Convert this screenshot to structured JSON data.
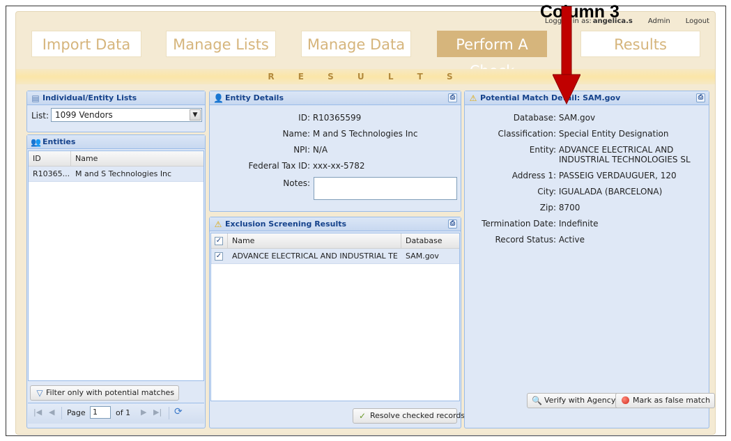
{
  "annotation": {
    "label": "Column 3",
    "arrow_color": "#c00000"
  },
  "user_bar": {
    "logged_as_label": "Logged in as:",
    "username": "angelica.s",
    "admin": "Admin",
    "logout": "Logout"
  },
  "nav": {
    "tabs": [
      "Import Data",
      "Manage Lists",
      "Manage Data",
      "Perform A Check",
      "Results"
    ],
    "active": "Perform A Check"
  },
  "section_title": "R E S U L T S",
  "lists_panel": {
    "title": "Individual/Entity Lists",
    "list_label": "List:",
    "list_value": "1099 Vendors"
  },
  "entities_panel": {
    "title": "Entities",
    "columns": [
      "ID",
      "Name"
    ],
    "rows": [
      [
        "R10365...",
        "M and S Technologies Inc"
      ]
    ],
    "filter_button": "Filter only with potential matches",
    "pager": {
      "page_label": "Page",
      "page_value": "1",
      "of_label": "of 1"
    }
  },
  "entity_details": {
    "title": "Entity Details",
    "fields": [
      {
        "label": "ID:",
        "value": "R10365599"
      },
      {
        "label": "Name:",
        "value": "M and S Technologies Inc"
      },
      {
        "label": "NPI:",
        "value": "N/A"
      },
      {
        "label": "Federal Tax ID:",
        "value": "xxx-xx-5782"
      },
      {
        "label": "Notes:",
        "value": ""
      }
    ]
  },
  "exclusion_panel": {
    "title": "Exclusion Screening Results",
    "columns": [
      "Name",
      "Database"
    ],
    "rows": [
      [
        "ADVANCE ELECTRICAL AND INDUSTRIAL TEC...",
        "SAM.gov"
      ]
    ],
    "resolve_button": "Resolve checked records"
  },
  "match_panel": {
    "title": "Potential Match Detail: SAM.gov",
    "fields": [
      {
        "label": "Database:",
        "value": "SAM.gov"
      },
      {
        "label": "Classification:",
        "value": "Special Entity Designation"
      },
      {
        "label": "Entity:",
        "value": "ADVANCE ELECTRICAL AND",
        "value2": "INDUSTRIAL TECHNOLOGIES SL"
      },
      {
        "label": "Address 1:",
        "value": "PASSEIG VERDAUGUER, 120"
      },
      {
        "label": "City:",
        "value": "IGUALADA (BARCELONA)"
      },
      {
        "label": "Zip:",
        "value": "8700"
      },
      {
        "label": "Termination Date:",
        "value": "Indefinite"
      },
      {
        "label": "Record Status:",
        "value": "Active"
      }
    ],
    "verify_button": "Verify with Agency",
    "false_match_button": "Mark as false match"
  }
}
